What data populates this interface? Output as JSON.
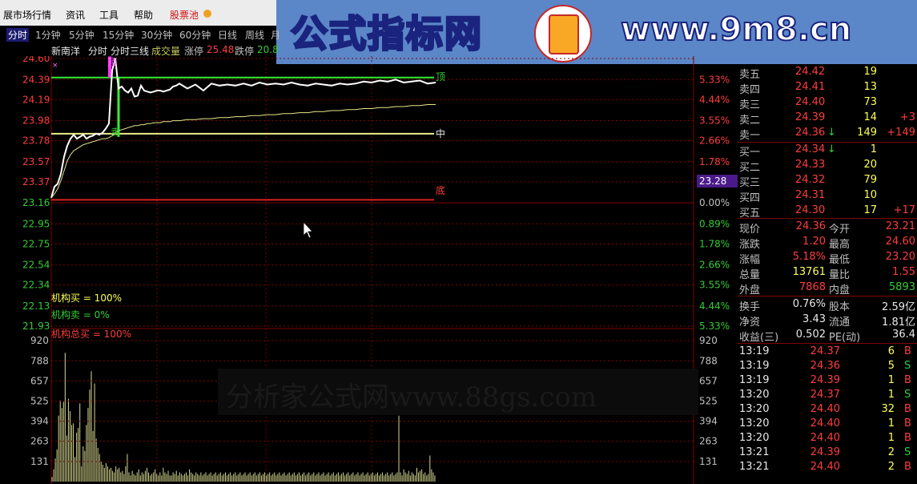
{
  "menu": [
    "展市场行情",
    "资讯",
    "工具",
    "帮助",
    "股票池"
  ],
  "tabs": [
    "分时",
    "1分钟",
    "5分钟",
    "15分钟",
    "30分钟",
    "60分钟",
    "日线",
    "周线",
    "月"
  ],
  "banner": {
    "title_cn": "公式指标网",
    "url": "www.9m8.cn"
  },
  "info_bar": {
    "stock": "新南洋",
    "mode": "分时",
    "indicator": "分时三线",
    "volume_label": "成交量",
    "limit_up_label": "涨停",
    "limit_up": "25.48",
    "limit_down_label": "跌停",
    "limit_down": "20.8"
  },
  "price_axis": [
    "24.60",
    "24.39",
    "24.19",
    "23.98",
    "23.78",
    "23.57",
    "23.37",
    "23.16",
    "22.95",
    "22.75",
    "22.54",
    "22.34",
    "22.13",
    "21.93"
  ],
  "pct_axis": [
    "5.33%",
    "4.44%",
    "3.55%",
    "2.66%",
    "1.78%",
    "0.89%",
    "0.00%",
    "0.89%",
    "1.78%",
    "2.66%",
    "3.55%",
    "4.44%",
    "5.33%"
  ],
  "prev_close_tag": "23.28",
  "chart_markers": {
    "top": "顶",
    "mid": "中",
    "bottom": "底",
    "sell": "卖"
  },
  "indicator_labels": {
    "buy": "机构买 = 100%",
    "sell": "机构卖 = 0%",
    "total": "机构总买 = 100%"
  },
  "volume_axis": [
    "920",
    "788",
    "657",
    "525",
    "394",
    "263",
    "131"
  ],
  "watermark": "分析家公式网www.88gs.com",
  "chart_data": {
    "type": "line",
    "title": "",
    "x": [
      0,
      2,
      4,
      6,
      8,
      10,
      12,
      14,
      16,
      18,
      20,
      22,
      24,
      26,
      28,
      30,
      32,
      34,
      36,
      38,
      40,
      42,
      44,
      46,
      48,
      50,
      52,
      54,
      56,
      58,
      60,
      62,
      64,
      66,
      68,
      70,
      72,
      74,
      76,
      78,
      80,
      85,
      90,
      95,
      100,
      105,
      110,
      115,
      120,
      125,
      130,
      135,
      140,
      145,
      150,
      155,
      160,
      165,
      170,
      175,
      180,
      185,
      190,
      195,
      200,
      205,
      210,
      215,
      220,
      225,
      230,
      235,
      240
    ],
    "series": [
      {
        "values": [
          23.21,
          23.32,
          23.35,
          23.45,
          23.62,
          23.73,
          23.8,
          23.84,
          23.8,
          23.82,
          23.84,
          23.8,
          23.82,
          23.83,
          23.85,
          23.84,
          23.86,
          23.9,
          23.95,
          24.48,
          24.6,
          24.3,
          24.32,
          24.28,
          24.26,
          24.3,
          24.22,
          24.23,
          24.33,
          24.28,
          24.27,
          24.26,
          24.27,
          24.28,
          24.28,
          24.27,
          24.28,
          24.29,
          24.32,
          24.33,
          24.35,
          24.3,
          24.34,
          24.28,
          24.35,
          24.33,
          24.34,
          24.33,
          24.35,
          24.33,
          24.36,
          24.34,
          24.35,
          24.34,
          24.36,
          24.34,
          24.33,
          24.35,
          24.34,
          24.33,
          24.35,
          24.34,
          24.35,
          24.37,
          24.36,
          24.38,
          24.37,
          24.39,
          24.36,
          24.37,
          24.38,
          24.35,
          24.36
        ]
      },
      {
        "values": [
          23.21,
          23.25,
          23.3,
          23.38,
          23.48,
          23.58,
          23.64,
          23.68,
          23.7,
          23.72,
          23.74,
          23.75,
          23.76,
          23.77,
          23.78,
          23.79,
          23.8,
          23.8,
          23.81,
          23.83,
          23.86,
          23.88,
          23.89,
          23.9,
          23.91,
          23.92,
          23.93,
          23.93,
          23.94,
          23.94,
          23.95,
          23.95,
          23.96,
          23.96,
          23.96,
          23.97,
          23.97,
          23.97,
          23.98,
          23.98,
          23.98,
          23.99,
          23.99,
          24.0,
          24.0,
          24.01,
          24.01,
          24.02,
          24.02,
          24.03,
          24.03,
          24.04,
          24.04,
          24.05,
          24.05,
          24.06,
          24.06,
          24.07,
          24.07,
          24.08,
          24.08,
          24.09,
          24.09,
          24.1,
          24.1,
          24.11,
          24.11,
          24.12,
          24.12,
          24.13,
          24.13,
          24.14,
          24.14
        ]
      }
    ],
    "levels": {
      "top": 24.41,
      "mid": 23.85,
      "bottom": 23.19,
      "prev_close": 23.28
    },
    "ylim": [
      21.93,
      24.6
    ],
    "volume": [
      30,
      80,
      150,
      210,
      430,
      530,
      480,
      520,
      840,
      300,
      540,
      460,
      370,
      380,
      160,
      320,
      350,
      510,
      100,
      230,
      200,
      370,
      480,
      600,
      720,
      330,
      640,
      280,
      220,
      180,
      130,
      110,
      90,
      120,
      100,
      80,
      90,
      70,
      60,
      100,
      80,
      90,
      60,
      70,
      50,
      100,
      180,
      60,
      40,
      70,
      50,
      40,
      60,
      80,
      40,
      60,
      50,
      70,
      90,
      60,
      40,
      50,
      60,
      80,
      50,
      40,
      60,
      40,
      90,
      60,
      50,
      70,
      40,
      40,
      60,
      50,
      70,
      40,
      60,
      50,
      40,
      50,
      60,
      40,
      80,
      60,
      50,
      40,
      60,
      50,
      40,
      60,
      40,
      50,
      60,
      40,
      50,
      60,
      40,
      50,
      60,
      40,
      50,
      60,
      40,
      50,
      60,
      40,
      50,
      60,
      40,
      50,
      60,
      40,
      50,
      60,
      40,
      50,
      60,
      40,
      50,
      60,
      40,
      50,
      60,
      40,
      50,
      60,
      40,
      50,
      60,
      40,
      50,
      60,
      40,
      50,
      60,
      40,
      50,
      60,
      40,
      50,
      60,
      40,
      50,
      60,
      40,
      50,
      60,
      40,
      50,
      60,
      40,
      50,
      60,
      40,
      50,
      60,
      40,
      50,
      60,
      40,
      50,
      60,
      40,
      50,
      60,
      40,
      50,
      60,
      40,
      50,
      60,
      40,
      50,
      60,
      40,
      50,
      60,
      40,
      50,
      60,
      40,
      50,
      60,
      40,
      50,
      60,
      40,
      50,
      60,
      40,
      50,
      60,
      40,
      50,
      60,
      40,
      50,
      60,
      40,
      50,
      60,
      40,
      50,
      60,
      40,
      50,
      60,
      40,
      50,
      60,
      430,
      60,
      40,
      80,
      60,
      50,
      70,
      40,
      60,
      50,
      40,
      90,
      60,
      70,
      80,
      50,
      60,
      40,
      50,
      170,
      80,
      60,
      40
    ],
    "volume_ylim": [
      0,
      920
    ]
  },
  "order_book": {
    "asks": [
      {
        "label": "卖五",
        "price": "24.42",
        "vol": "19",
        "chg": ""
      },
      {
        "label": "卖四",
        "price": "24.41",
        "vol": "13",
        "chg": ""
      },
      {
        "label": "卖三",
        "price": "24.40",
        "vol": "73",
        "chg": ""
      },
      {
        "label": "卖二",
        "price": "24.39",
        "vol": "14",
        "chg": "+3"
      },
      {
        "label": "卖一",
        "price": "24.36",
        "vol": "149",
        "chg": "+149"
      }
    ],
    "bids": [
      {
        "label": "买一",
        "price": "24.34",
        "vol": "1",
        "chg": ""
      },
      {
        "label": "买二",
        "price": "24.33",
        "vol": "20",
        "chg": ""
      },
      {
        "label": "买三",
        "price": "24.32",
        "vol": "79",
        "chg": ""
      },
      {
        "label": "买四",
        "price": "24.31",
        "vol": "10",
        "chg": ""
      },
      {
        "label": "买五",
        "price": "24.30",
        "vol": "17",
        "chg": "+17"
      }
    ]
  },
  "stats": [
    {
      "l1": "现价",
      "v1": "24.36",
      "c1": "red",
      "l2": "今开",
      "v2": "23.21",
      "c2": "red"
    },
    {
      "l1": "涨跌",
      "v1": "1.20",
      "c1": "red",
      "l2": "最高",
      "v2": "24.60",
      "c2": "red"
    },
    {
      "l1": "涨幅",
      "v1": "5.18%",
      "c1": "red",
      "l2": "最低",
      "v2": "23.20",
      "c2": "red"
    },
    {
      "l1": "总量",
      "v1": "13761",
      "c1": "yel",
      "l2": "量比",
      "v2": "1.55",
      "c2": "red"
    },
    {
      "l1": "外盘",
      "v1": "7868",
      "c1": "red",
      "l2": "内盘",
      "v2": "5893",
      "c2": "grn"
    }
  ],
  "fundamentals": [
    {
      "l1": "换手",
      "v1": "0.76%",
      "l2": "股本",
      "v2": "2.59亿"
    },
    {
      "l1": "净资",
      "v1": "3.43",
      "l2": "流通",
      "v2": "1.81亿"
    },
    {
      "l1": "收益(三)",
      "v1": "0.502",
      "l2": "PE(动)",
      "v2": "36.4"
    }
  ],
  "trades": [
    {
      "time": "13:19",
      "price": "24.37",
      "vol": "6",
      "side": "B"
    },
    {
      "time": "13:19",
      "price": "24.36",
      "vol": "5",
      "side": "S"
    },
    {
      "time": "13:19",
      "price": "24.39",
      "vol": "1",
      "side": "B"
    },
    {
      "time": "13:20",
      "price": "24.37",
      "vol": "1",
      "side": "S"
    },
    {
      "time": "13:20",
      "price": "24.40",
      "vol": "32",
      "side": "B"
    },
    {
      "time": "13:20",
      "price": "24.40",
      "vol": "1",
      "side": "B"
    },
    {
      "time": "13:20",
      "price": "24.40",
      "vol": "1",
      "side": "B"
    },
    {
      "time": "13:21",
      "price": "24.39",
      "vol": "2",
      "side": "S"
    },
    {
      "time": "13:21",
      "price": "24.40",
      "vol": "2",
      "side": "B"
    }
  ],
  "colors": {
    "up": "#ff3c3c",
    "down": "#33cc33",
    "grid": "#800000",
    "price": "#ffffff",
    "avg": "#e8e88a"
  }
}
